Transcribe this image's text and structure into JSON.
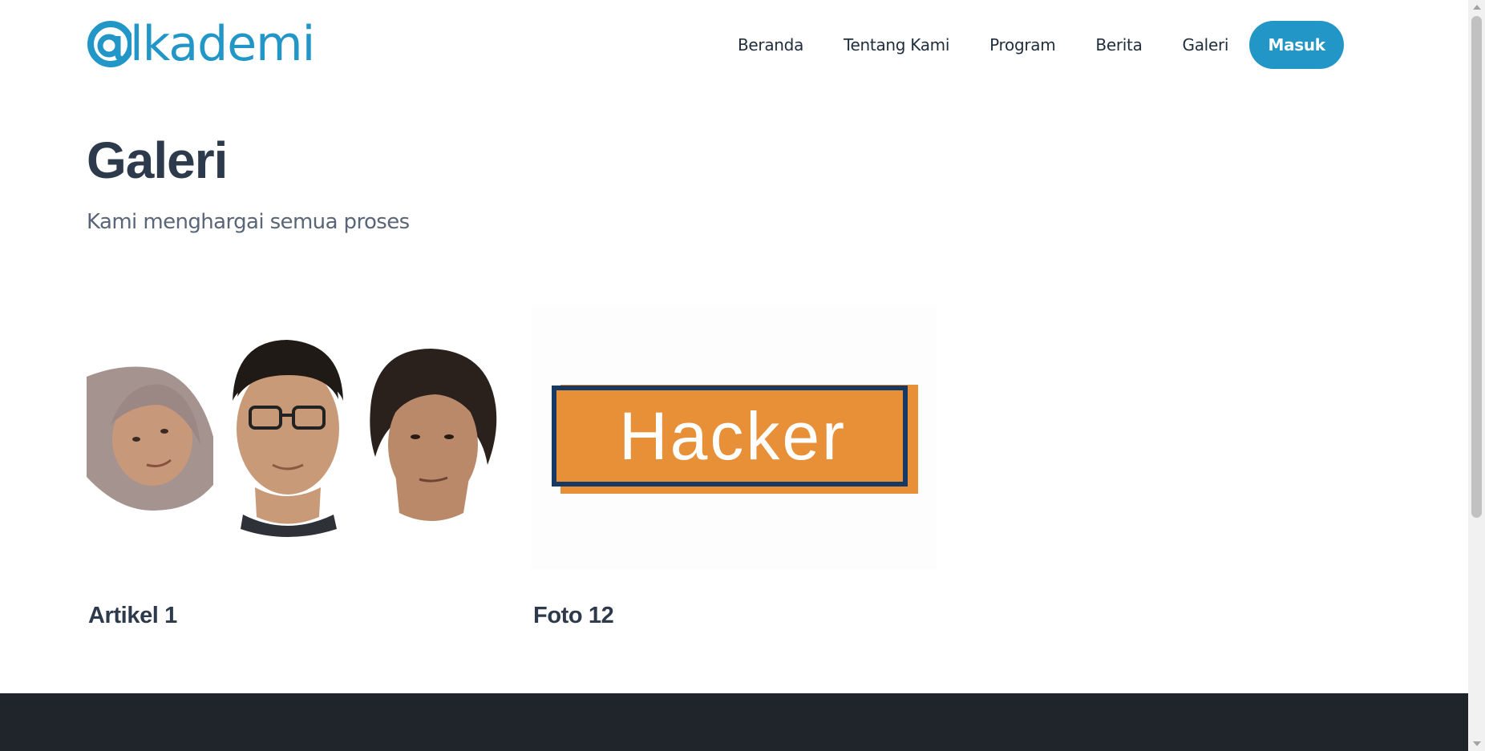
{
  "brand": {
    "name": "lkademi",
    "color": "#2196c7"
  },
  "nav": {
    "items": [
      "Beranda",
      "Tentang Kami",
      "Program",
      "Berita",
      "Galeri"
    ],
    "login_label": "Masuk"
  },
  "header": {
    "title": "Galeri",
    "subtitle": "Kami menghargai semua proses"
  },
  "gallery": {
    "cards": [
      {
        "title": "Artikel 1",
        "image": "three-portraits"
      },
      {
        "title": "Foto 12",
        "image": "hacker-sign",
        "image_text": "Hacker"
      }
    ]
  },
  "colors": {
    "footer": "#20242b",
    "title": "#2d3a4b",
    "hacker_orange": "#e89038",
    "hacker_navy": "#163a63"
  }
}
